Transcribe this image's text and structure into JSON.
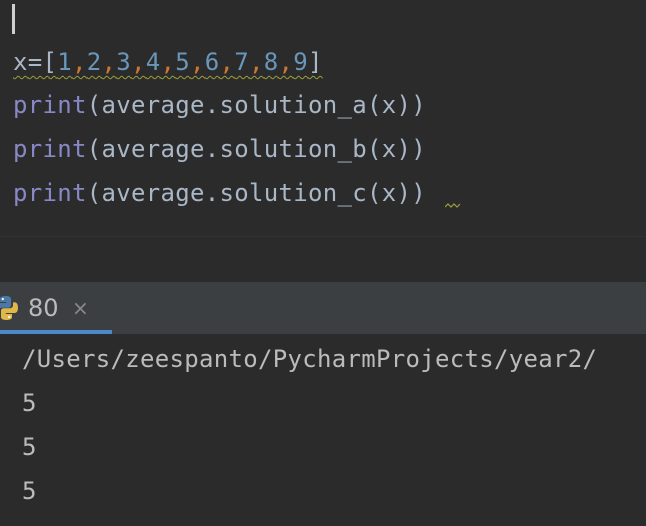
{
  "editor": {
    "lines": [
      {
        "var": "x",
        "op": "=[",
        "nums": [
          "1",
          "2",
          "3",
          "4",
          "5",
          "6",
          "7",
          "8",
          "9"
        ],
        "close": "]"
      },
      {
        "fn": "print",
        "open": "(",
        "call": "average.solution_a(x)",
        "close": ")"
      },
      {
        "fn": "print",
        "open": "(",
        "call": "average.solution_b(x)",
        "close": ")"
      },
      {
        "fn": "print",
        "open": "(",
        "call": "average.solution_c(x)",
        "close": ")"
      }
    ]
  },
  "run_panel": {
    "tab_label": "80",
    "tab_close_glyph": "×",
    "tab_icon": "python-icon"
  },
  "console": {
    "lines": [
      "/Users/zeespanto/PycharmProjects/year2/",
      "5",
      "5",
      "5"
    ]
  },
  "colors": {
    "background": "#2b2b2b",
    "panel_header": "#3c3f41",
    "keyword_print": "#8888c6",
    "number": "#6897bb",
    "comma": "#cc7832",
    "default_text": "#a9b7c6",
    "console_text": "#bbbbbb",
    "tab_underline": "#4a88c7"
  }
}
